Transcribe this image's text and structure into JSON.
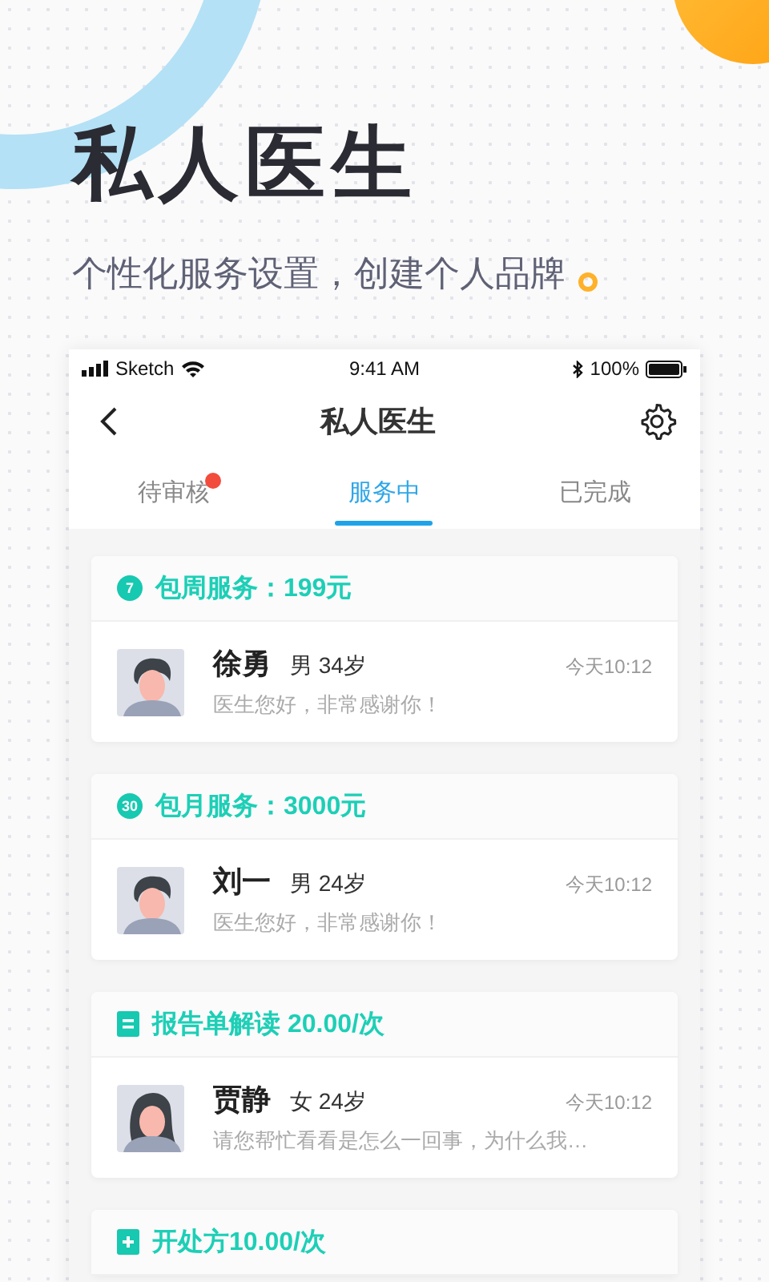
{
  "headline": "私人医生",
  "subtitle": "个性化服务设置，创建个人品牌",
  "status_bar": {
    "carrier": "Sketch",
    "time": "9:41 AM",
    "battery": "100%"
  },
  "nav_bar": {
    "title": "私人医生"
  },
  "tabs": [
    {
      "label": "待审核",
      "selected": false,
      "dot": true
    },
    {
      "label": "服务中",
      "selected": true,
      "dot": false
    },
    {
      "label": "已完成",
      "selected": false,
      "dot": false
    }
  ],
  "services": [
    {
      "kind": "badge",
      "badge": "7",
      "title": "包周服务：199元",
      "patient": {
        "kind": "male",
        "name": "徐勇",
        "info": "男 34岁",
        "time": "今天10:12",
        "message": "医生您好，非常感谢你！"
      }
    },
    {
      "kind": "badge",
      "badge": "30",
      "title": "包月服务：3000元",
      "patient": {
        "kind": "male",
        "name": "刘一",
        "info": "男 24岁",
        "time": "今天10:12",
        "message": "医生您好，非常感谢你！"
      }
    },
    {
      "kind": "report",
      "title": "报告单解读 20.00/次",
      "patient": {
        "kind": "female",
        "name": "贾静",
        "info": "女 24岁",
        "time": "今天10:12",
        "message": "请您帮忙看看是怎么一回事，为什么我…"
      }
    },
    {
      "kind": "prescription",
      "title": "开处方10.00/次"
    }
  ]
}
